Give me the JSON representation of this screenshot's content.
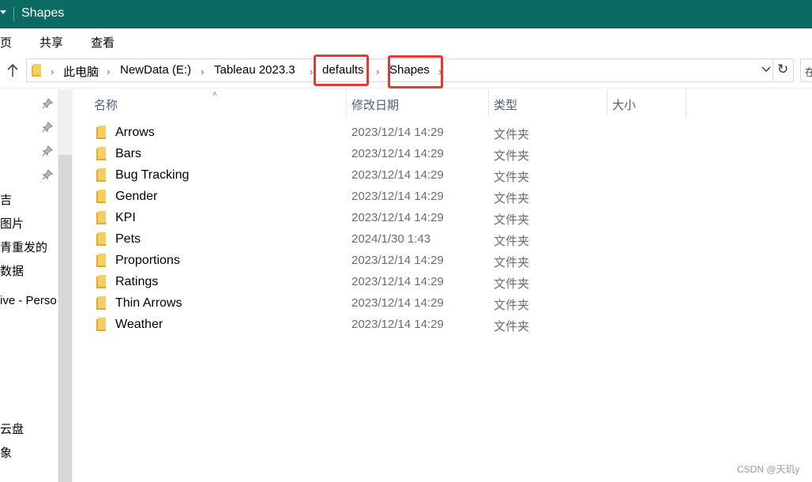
{
  "window": {
    "title": "Shapes"
  },
  "ribbon": {
    "tabs": [
      "页",
      "共享",
      "查看"
    ]
  },
  "address": {
    "crumbs": [
      "此电脑",
      "NewData (E:)",
      "Tableau 2023.3",
      "defaults",
      "Shapes"
    ]
  },
  "search": {
    "hint_char": "在"
  },
  "sidebar": {
    "items": [
      "吉",
      "图片",
      "青重发的",
      "数据",
      "ive - Perso",
      "云盘",
      "象"
    ]
  },
  "columns": {
    "name": "名称",
    "modified": "修改日期",
    "type": "类型",
    "size": "大小"
  },
  "files": [
    {
      "name": "Arrows",
      "modified": "2023/12/14 14:29",
      "type": "文件夹"
    },
    {
      "name": "Bars",
      "modified": "2023/12/14 14:29",
      "type": "文件夹"
    },
    {
      "name": "Bug Tracking",
      "modified": "2023/12/14 14:29",
      "type": "文件夹"
    },
    {
      "name": "Gender",
      "modified": "2023/12/14 14:29",
      "type": "文件夹"
    },
    {
      "name": "KPI",
      "modified": "2023/12/14 14:29",
      "type": "文件夹"
    },
    {
      "name": "Pets",
      "modified": "2024/1/30 1:43",
      "type": "文件夹"
    },
    {
      "name": "Proportions",
      "modified": "2023/12/14 14:29",
      "type": "文件夹"
    },
    {
      "name": "Ratings",
      "modified": "2023/12/14 14:29",
      "type": "文件夹"
    },
    {
      "name": "Thin Arrows",
      "modified": "2023/12/14 14:29",
      "type": "文件夹"
    },
    {
      "name": "Weather",
      "modified": "2023/12/14 14:29",
      "type": "文件夹"
    }
  ],
  "watermark": "CSDN @天玑y",
  "colors": {
    "titlebar": "#0b6b62",
    "folder": "#f2c14e",
    "highlight": "#e53935"
  }
}
